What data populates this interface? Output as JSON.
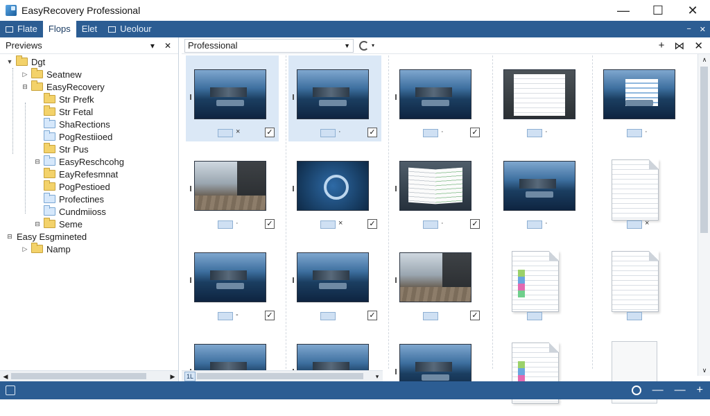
{
  "window": {
    "title": "EasyRecovery Professional",
    "controls": {
      "minimize": "—",
      "maximize": "☐",
      "close": "✕"
    }
  },
  "menu": {
    "items": [
      "Flate",
      "Flops",
      "Elet",
      "Ueolour"
    ],
    "active_index": 1,
    "right_controls": [
      "−",
      "✕"
    ]
  },
  "left_pane": {
    "header": "Previews",
    "header_controls": {
      "dropdown": "▾",
      "close": "✕"
    },
    "tree": [
      {
        "label": "Dgt",
        "level": 0,
        "expander": "▼",
        "folder": "yellow"
      },
      {
        "label": "Seatnew",
        "level": 1,
        "expander": "▷",
        "folder": "yellow"
      },
      {
        "label": "EasyRecovery",
        "level": 1,
        "expander": "⊟",
        "folder": "yellow"
      },
      {
        "label": "Str Prefk",
        "level": 2,
        "expander": "",
        "folder": "yellow"
      },
      {
        "label": "Str Fetal",
        "level": 2,
        "expander": "",
        "folder": "yellow"
      },
      {
        "label": "ShaRections",
        "level": 2,
        "expander": "",
        "folder": "blue"
      },
      {
        "label": "PogRestiioed",
        "level": 2,
        "expander": "",
        "folder": "blue"
      },
      {
        "label": "Str Pus",
        "level": 2,
        "expander": "",
        "folder": "yellow"
      },
      {
        "label": "EasyReschcohg",
        "level": 2,
        "expander": "⊟",
        "folder": "blue"
      },
      {
        "label": "EayRefesmnat",
        "level": 2,
        "expander": "",
        "folder": "yellow"
      },
      {
        "label": "PogPestioed",
        "level": 2,
        "expander": "",
        "folder": "yellow"
      },
      {
        "label": "Profectines",
        "level": 2,
        "expander": "",
        "folder": "blue"
      },
      {
        "label": "Cundmiioss",
        "level": 2,
        "expander": "",
        "folder": "blue"
      },
      {
        "label": "Seme",
        "level": 2,
        "expander": "⊟",
        "folder": "yellow"
      },
      {
        "label": "Easy Esgmineted",
        "level": 0,
        "expander": "⊟",
        "folder": ""
      },
      {
        "label": "Namp",
        "level": 1,
        "expander": "▷",
        "folder": "yellow"
      }
    ],
    "scroll_left": "◀",
    "scroll_right": "▶"
  },
  "right_pane": {
    "location_combo": "Professional",
    "combo_caret": "▼",
    "toolbar_caret": "▾",
    "toolbar_right": [
      "+",
      "⋈",
      "✕"
    ],
    "hscroll_badge": "1L",
    "hscroll_caret": "▾",
    "vscroll": {
      "up": "∧",
      "down": "∨"
    }
  },
  "tiles": [
    {
      "kind": "bldg",
      "selected": true,
      "mark": "×",
      "checked": true
    },
    {
      "kind": "bldg",
      "selected": true,
      "mark": "·",
      "checked": true
    },
    {
      "kind": "bldg",
      "selected": false,
      "mark": "·",
      "checked": true
    },
    {
      "kind": "docphoto",
      "selected": false,
      "mark": "·",
      "checked": false
    },
    {
      "kind": "bldgdoc",
      "selected": false,
      "mark": "·",
      "checked": false
    },
    {
      "kind": "street",
      "selected": false,
      "mark": "·",
      "checked": true
    },
    {
      "kind": "logo",
      "selected": false,
      "mark": "×",
      "checked": true
    },
    {
      "kind": "book",
      "selected": false,
      "mark": "·",
      "checked": true
    },
    {
      "kind": "bldg",
      "selected": false,
      "mark": "·",
      "checked": false
    },
    {
      "kind": "doc",
      "selected": false,
      "mark": "×",
      "checked": false
    },
    {
      "kind": "bldg",
      "selected": false,
      "mark": "-",
      "checked": true
    },
    {
      "kind": "bldg",
      "selected": false,
      "mark": "",
      "checked": true
    },
    {
      "kind": "street",
      "selected": false,
      "mark": "",
      "checked": true
    },
    {
      "kind": "doccolor",
      "selected": false,
      "mark": "",
      "checked": false
    },
    {
      "kind": "doc",
      "selected": false,
      "mark": "",
      "checked": false
    },
    {
      "kind": "bldg",
      "selected": false,
      "mark": "",
      "checked": false
    },
    {
      "kind": "bldg",
      "selected": false,
      "mark": "",
      "checked": false
    },
    {
      "kind": "bldg",
      "selected": false,
      "mark": "",
      "checked": false
    },
    {
      "kind": "doccolor",
      "selected": false,
      "mark": "",
      "checked": false
    },
    {
      "kind": "blank",
      "selected": false,
      "mark": "",
      "checked": false
    }
  ],
  "check_glyph": "✓",
  "statusbar": {
    "controls": [
      "—",
      "—",
      "+"
    ]
  },
  "colors": {
    "accent": "#2c5d93",
    "selection": "#dbe8f6",
    "folder": "#f3d26a"
  }
}
